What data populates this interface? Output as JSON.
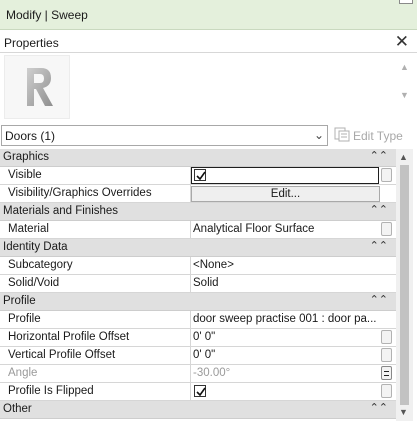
{
  "ribbon": {
    "title": "Modify | Sweep"
  },
  "properties": {
    "header": "Properties",
    "type_selector": {
      "value": "Doors (1)"
    },
    "edit_type_label": "Edit Type"
  },
  "groups": {
    "graphics": {
      "label": "Graphics",
      "visible": {
        "name": "Visible",
        "checked": true
      },
      "vg_overrides": {
        "name": "Visibility/Graphics Overrides",
        "button": "Edit..."
      }
    },
    "materials": {
      "label": "Materials and Finishes",
      "material": {
        "name": "Material",
        "value": "Analytical Floor Surface"
      }
    },
    "identity": {
      "label": "Identity Data",
      "subcategory": {
        "name": "Subcategory",
        "value": "<None>"
      },
      "solid_void": {
        "name": "Solid/Void",
        "value": "Solid"
      }
    },
    "profile": {
      "label": "Profile",
      "profile": {
        "name": "Profile",
        "value": "door sweep practise 001 : door pa..."
      },
      "h_offset": {
        "name": "Horizontal Profile Offset",
        "value": "0'  0\""
      },
      "v_offset": {
        "name": "Vertical Profile Offset",
        "value": "0'  0\""
      },
      "angle": {
        "name": "Angle",
        "value": "-30.00°"
      },
      "flipped": {
        "name": "Profile Is Flipped",
        "checked": true
      }
    },
    "other": {
      "label": "Other"
    }
  },
  "icons": {
    "collapse": "double-chevron-up-icon",
    "close": "close-icon",
    "family": "revit-r-icon"
  }
}
